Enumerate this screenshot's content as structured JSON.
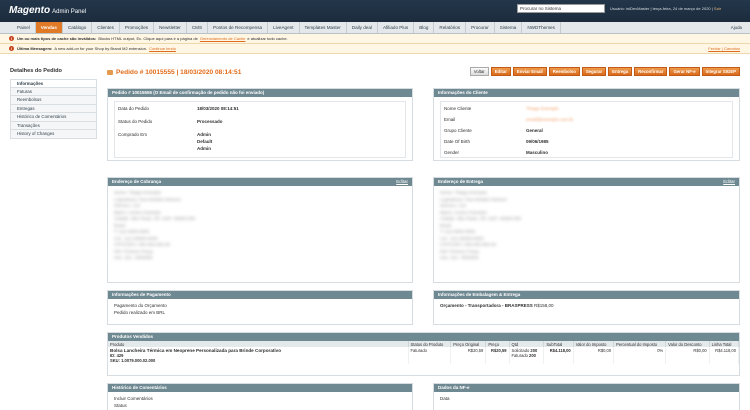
{
  "header": {
    "logo": "Magento",
    "logo_sub": "Admin Panel",
    "search_value": "Procurar no Sistema",
    "user_text": "Usuário: iniDevMaster | terça-feira, 24 de março de 2020 |",
    "logout": "Sair"
  },
  "nav": {
    "items": [
      "Painel",
      "Vendas",
      "Catálogo",
      "Clientes",
      "Promoções",
      "Newsletter",
      "CMS",
      "Pontos de Recompensa",
      "LiveAgent",
      "Templates Master",
      "Daily deal",
      "Afiliado Plus",
      "Blog",
      "Relatórios",
      "Procurar",
      "Sistema",
      "NWDThemes"
    ],
    "help": "Ajuda"
  },
  "notices": {
    "cache_bold": "Um ou mais tipos de cache são inválidos:",
    "cache_text": "Blocks HTML output, Ec. Clique aqui para ir a página de",
    "cache_link": "Gerenciamento de Cache",
    "cache_tail": "e atualizar todo cache.",
    "msg_bold": "Última Mensagem:",
    "msg_text": "A new add-on for your Shop by Brand M2 extension.",
    "msg_link": "Continue lendo",
    "close": "Fechar",
    "close2": "Cancelar"
  },
  "sidebar": {
    "title": "Detalhes do Pedido",
    "items": [
      "Informações",
      "Faturas",
      "Reembolsos",
      "Entregas",
      "Histórico de Comentários",
      "Transações",
      "History of Changes"
    ]
  },
  "order": {
    "title": "Pedido # 10015555 | 18/03/2020 08:14:51",
    "buttons": [
      "Voltar",
      "Editar",
      "Enviar Email",
      "Reembolso",
      "Segurar",
      "Entrega",
      "Reconfirmar",
      "Gerar NF-e",
      "Integrar SIGEP"
    ]
  },
  "order_panel": {
    "head": "Pedido # 10015555 (O Email de confirmação de pedido não foi enviado)",
    "date_label": "Data do Pedido",
    "date_value": "18/03/2020 08:14:51",
    "status_label": "Status do Pedido",
    "status_value": "Processado",
    "bought_label": "Comprado Em",
    "bought_1": "Admin",
    "bought_2": "Default",
    "bought_3": "Admin"
  },
  "client_panel": {
    "head": "Informações do Cliente",
    "name_label": "Nome Cliente",
    "name_value": "Thiago Exemplo",
    "email_label": "Email",
    "email_value": "email@exemplo.com.br",
    "group_label": "Grupo Cliente",
    "group_value": "General",
    "dob_label": "Date Of Birth",
    "dob_value": "09/06/1985",
    "gender_label": "Gender",
    "gender_value": "Masculino"
  },
  "billing": {
    "head": "Endereço de Cobrança",
    "edit": "Editar",
    "lines": [
      "Nome: Thiago Exemplo",
      "Logradouro: Rua Modelo Número",
      "Número: 123",
      "Bairro: Centro Exemplo",
      "Cidade: São Paulo, SP, CEP: 00000-000",
      "Brasil",
      "T: (11) 0000-0000",
      "Cel.: (11) 00000-0000",
      "CPF/CNPJ: 000.000.000-00",
      "Ref: Próximo Praça",
      "Insc. Est.: 0000000"
    ]
  },
  "shipping": {
    "head": "Endereço de Entrega",
    "edit": "Editar",
    "lines": [
      "Nome: Thiago Exemplo",
      "Logradouro: Rua Modelo Número",
      "Número: 123",
      "Bairro: Centro Exemplo",
      "Cidade: São Paulo, SP, CEP: 00000-000",
      "Brasil",
      "T: (11) 0000-0000",
      "Cel.: (11) 00000-0000",
      "CPF/CNPJ: 000.000.000-00",
      "Ref: Próximo Praça",
      "Insc. Est.: 0000000"
    ]
  },
  "payment": {
    "head": "Informações de Pagamento",
    "line1": "Pagamento do Orçamento",
    "line2": "Pedido realizado em BRL"
  },
  "shipping_info": {
    "head": "Informações de Embalagem & Entrega",
    "method": "Orçamento - Transportadora - BRASPRESS",
    "price": "R$158,00"
  },
  "products": {
    "head": "Produtos Vendidos",
    "columns": [
      "Produto",
      "Status do Produto",
      "Preço Original",
      "Preço",
      "Qtd",
      "SubTotal",
      "Valor do Imposto",
      "Percentual do Imposto",
      "Valor do Desconto",
      "Linha Total"
    ],
    "row": {
      "name": "Bolsa Lancheira Térmica em Neoprene Personalizada para Brinde Corporativo",
      "id": "ID: 429",
      "sku": "SKU: 1.0079.000.02.000",
      "status": "Faturado",
      "original": "R$20,59",
      "price": "R$20,59",
      "qty_label_1": "Solicitado",
      "qty_1": "200",
      "qty_label_2": "Faturado",
      "qty_2": "200",
      "subtotal": "R$4.118,00",
      "tax": "R$0,00",
      "tax_pct": "0%",
      "discount": "R$0,00",
      "total": "R$4.118,00"
    }
  },
  "comments": {
    "head": "Histórico de Comentários",
    "line1": "Incluir Comentários",
    "line2": "Status"
  },
  "nfe": {
    "head": "Dados da NF-e",
    "line1": "Data"
  }
}
